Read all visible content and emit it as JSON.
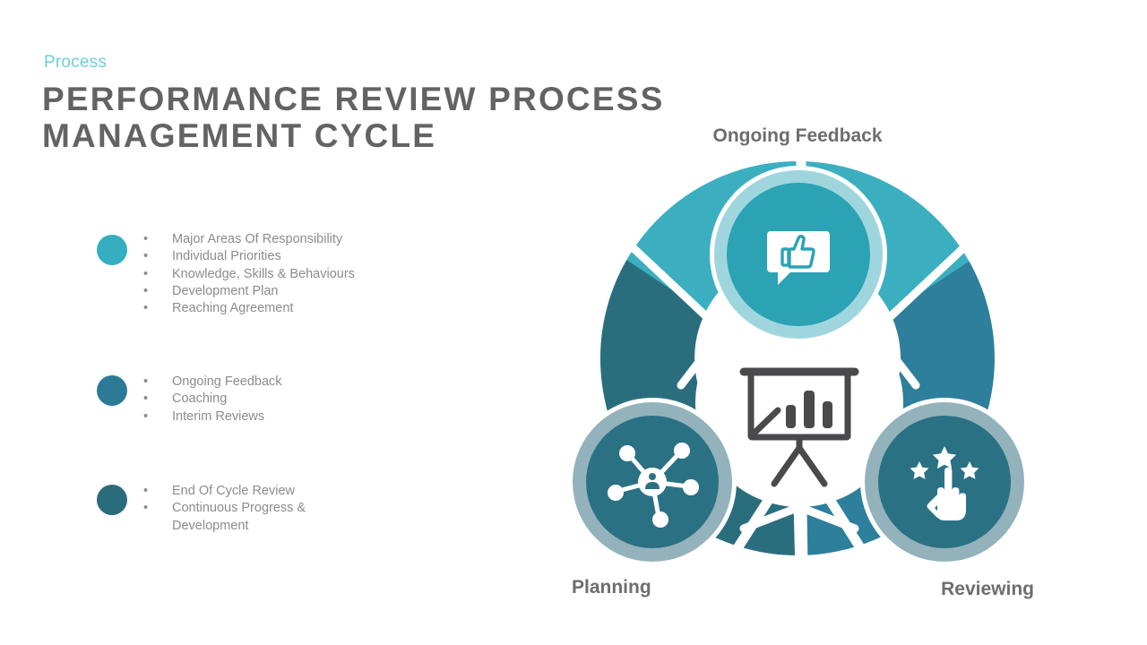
{
  "header": {
    "eyebrow": "Process",
    "title": "PERFORMANCE REVIEW PROCESS MANAGEMENT CYCLE"
  },
  "colors": {
    "eyebrow": "#6ecfd6",
    "title": "#636366",
    "label": "#6d6d70",
    "body_text": "#8c8c8f",
    "teal_light": "#3bafc0",
    "teal_medium": "#2d7f9b",
    "teal_dark": "#2a6e7e",
    "ring_light": "#9fd6de",
    "ring_gray": "#93b2bb",
    "background": "#ffffff"
  },
  "groups": [
    {
      "bullet_color": "#35aec0",
      "items": [
        "Major Areas Of Responsibility",
        "Individual  Priorities",
        "Knowledge,  Skills & Behaviours",
        "Development Plan",
        "Reaching Agreement"
      ]
    },
    {
      "bullet_color": "#2c7a96",
      "items": [
        "Ongoing  Feedback",
        "Coaching",
        "Interim  Reviews"
      ]
    },
    {
      "bullet_color": "#2a6c7c",
      "items": [
        "End Of Cycle Review",
        "Continuous  Progress &\n  Development"
      ]
    }
  ],
  "bullet_glyph": "•",
  "diagram": {
    "center_icon": "presentation-chart-icon",
    "nodes": [
      {
        "id": "ongoing-feedback",
        "label": "Ongoing Feedback",
        "icon": "thumbs-up-speech-bubble-icon",
        "fill": "#2ba3b5",
        "ring": "#9fd6de"
      },
      {
        "id": "planning",
        "label": "Planning",
        "icon": "network-people-icon",
        "fill": "#2a7184",
        "ring": "#93b2bb"
      },
      {
        "id": "reviewing",
        "label": "Reviewing",
        "icon": "hand-rating-stars-icon",
        "fill": "#2a7184",
        "ring": "#93b2bb"
      }
    ],
    "segments": [
      {
        "id": "top-left",
        "fill": "#3bafc0"
      },
      {
        "id": "top-right",
        "fill": "#3bafc0"
      },
      {
        "id": "right-upper",
        "fill": "#2d7f9b"
      },
      {
        "id": "right-lower",
        "fill": "#2d7f9b"
      },
      {
        "id": "left-upper",
        "fill": "#2a6e7e"
      },
      {
        "id": "left-lower",
        "fill": "#2a6e7e"
      }
    ]
  }
}
